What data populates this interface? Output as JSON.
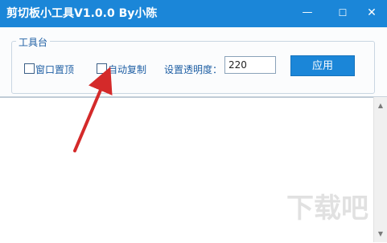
{
  "window": {
    "title": "剪切板小工具V1.0.0  By小陈",
    "minimize_icon": "minimize-icon",
    "maximize_icon": "maximize-icon",
    "close_icon": "close-icon",
    "minimize_glyph": "—",
    "maximize_glyph": "☐",
    "close_glyph": "✕"
  },
  "toolbox": {
    "legend": "工具台",
    "window_top_label": "窗口置顶",
    "window_top_checked": false,
    "auto_copy_label": "自动复制",
    "auto_copy_checked": false,
    "opacity_label": "设置透明度：",
    "opacity_value": "220",
    "apply_label": "应用"
  },
  "content": {
    "text": "",
    "scroll_up_glyph": "▲",
    "scroll_down_glyph": "▼"
  },
  "watermark": {
    "text": "下载吧"
  },
  "colors": {
    "titlebar": "#1b86d8",
    "accent_text": "#1f5fa4",
    "annotation_arrow": "#d42a2a"
  }
}
